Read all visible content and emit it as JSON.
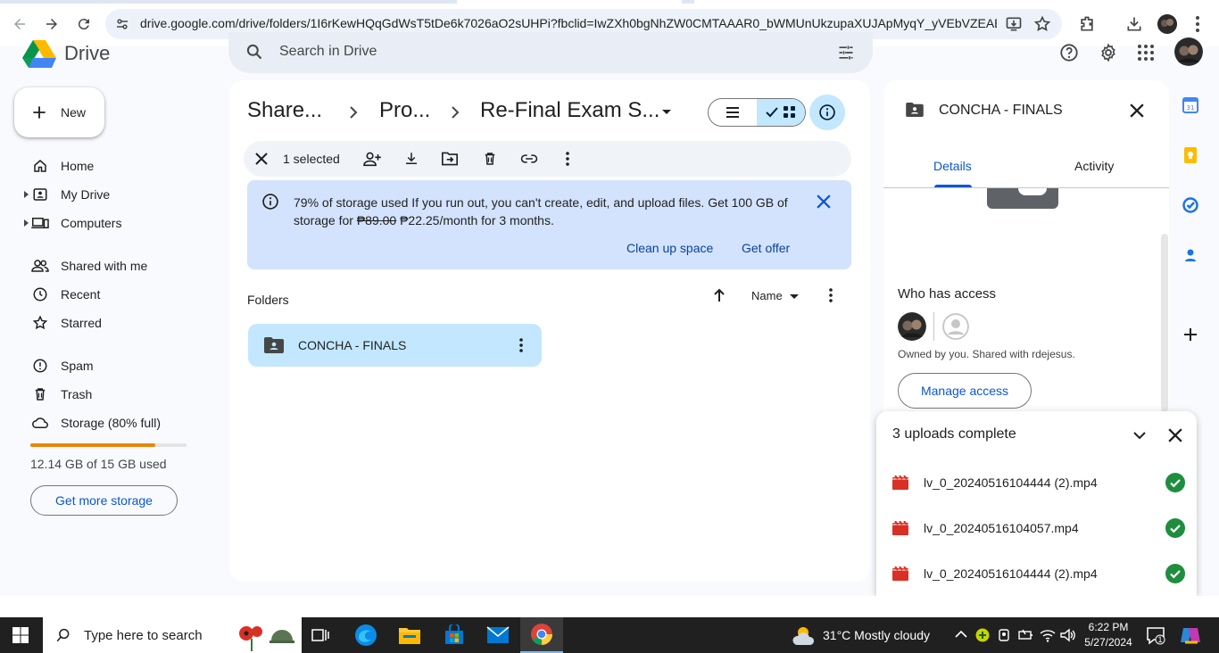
{
  "browser": {
    "url": "drive.google.com/drive/folders/1I6rKewHQqGdWsT5tDe6k7026aO2sUHPi?fbclid=IwZXh0bgNhZW0CMTAAAR0_bWMUnUkzupaXUJApMyqY_yVEbVZEABj...",
    "icons": [
      "back-icon",
      "forward-icon",
      "reload-icon",
      "site-info-icon",
      "install-app-icon",
      "bookmark-star-icon",
      "extensions-icon",
      "downloads-icon",
      "profile-avatar"
    ]
  },
  "app": {
    "name": "Drive",
    "search_placeholder": "Search in Drive"
  },
  "sidebar": {
    "new_label": "New",
    "items": [
      {
        "label": "Home",
        "icon": "home-icon"
      },
      {
        "label": "My Drive",
        "icon": "my-drive-icon"
      },
      {
        "label": "Computers",
        "icon": "computers-icon"
      },
      {
        "label": "Shared with me",
        "icon": "shared-icon"
      },
      {
        "label": "Recent",
        "icon": "recent-icon"
      },
      {
        "label": "Starred",
        "icon": "star-icon"
      },
      {
        "label": "Spam",
        "icon": "spam-icon"
      },
      {
        "label": "Trash",
        "icon": "trash-icon"
      },
      {
        "label": "Storage (80% full)",
        "icon": "cloud-icon"
      }
    ],
    "storage_fraction": 0.8,
    "storage_used_text": "12.14 GB of 15 GB used",
    "get_storage_label": "Get more storage"
  },
  "breadcrumb": [
    "Share...",
    "Pro...",
    "Re-Final Exam S..."
  ],
  "selection": {
    "text": "1 selected"
  },
  "banner": {
    "bold": "79% of storage used",
    "text1": " If you run out, you can't create, edit, and upload files. Get 100 GB of storage for ",
    "old_price": "₱89.00",
    "text2": " ₱22.25/month for 3 months.",
    "link1": "Clean up space",
    "link2": "Get offer"
  },
  "folders": {
    "header": "Folders",
    "sort_label": "Name",
    "items": [
      {
        "name": "CONCHA - FINALS"
      }
    ]
  },
  "details": {
    "title": "CONCHA - FINALS",
    "tabs": [
      "Details",
      "Activity"
    ],
    "who_has_access": "Who has access",
    "owned_text": "Owned by you. Shared with rdejesus.",
    "manage_label": "Manage access"
  },
  "uploads": {
    "title": "3 uploads complete",
    "files": [
      "lv_0_20240516104444 (2).mp4",
      "lv_0_20240516104057.mp4",
      "lv_0_20240516104444 (2).mp4"
    ]
  },
  "taskbar": {
    "search_placeholder": "Type here to search",
    "weather": "31°C  Mostly cloudy",
    "time": "6:22 PM",
    "date": "5/27/2024",
    "notification_count": "1"
  },
  "colors": {
    "accent": "#0b57d0",
    "selected": "#c2e7ff",
    "banner": "#d3e3fd",
    "success": "#1e8e3e",
    "storage_warn": "#ea8600"
  }
}
